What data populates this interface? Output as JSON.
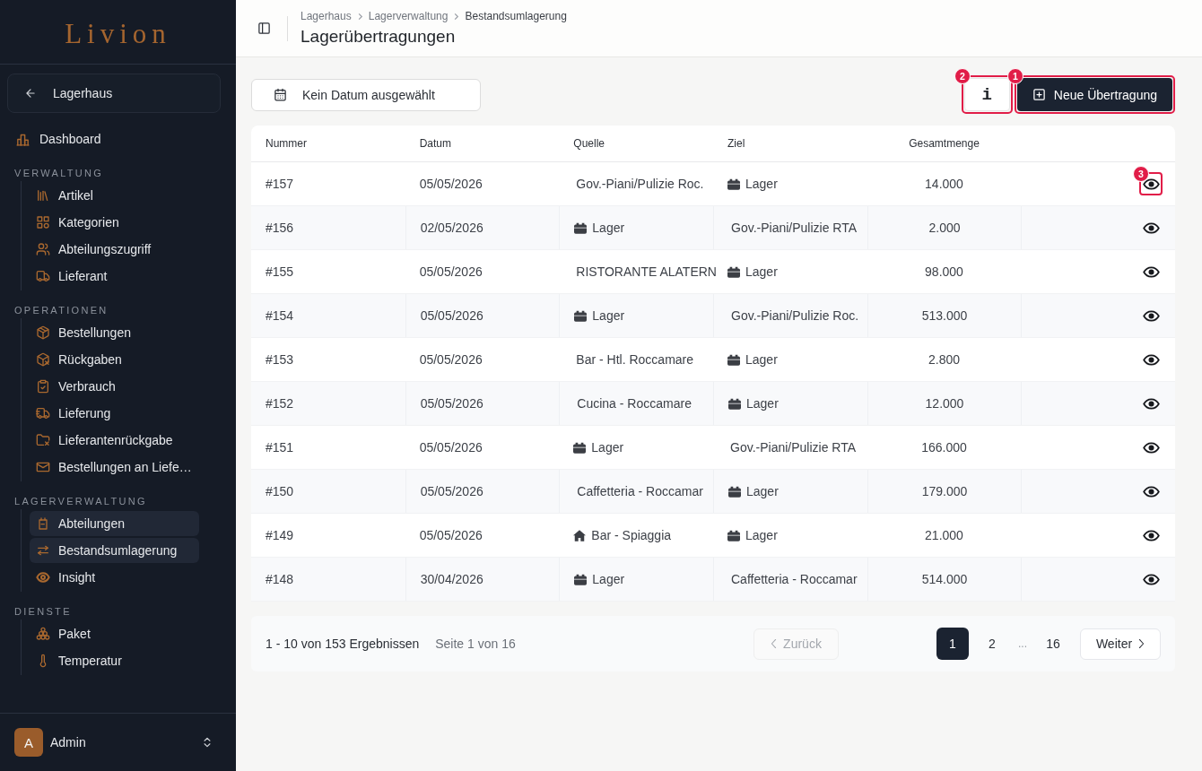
{
  "sidebar": {
    "logo": "Livion",
    "back_link": "Lagerhaus",
    "top_items": [
      {
        "label": "Dashboard",
        "selected": false
      }
    ],
    "sections": [
      {
        "title": "VERWALTUNG",
        "items": [
          {
            "label": "Artikel",
            "selected": false
          },
          {
            "label": "Kategorien",
            "selected": false
          },
          {
            "label": "Abteilungszugriff",
            "selected": false
          },
          {
            "label": "Lieferant",
            "selected": false
          }
        ]
      },
      {
        "title": "OPERATIONEN",
        "items": [
          {
            "label": "Bestellungen",
            "selected": false
          },
          {
            "label": "Rückgaben",
            "selected": false
          },
          {
            "label": "Verbrauch",
            "selected": false
          },
          {
            "label": "Lieferung",
            "selected": false
          },
          {
            "label": "Lieferantenrückgabe",
            "selected": false
          },
          {
            "label": "Bestellungen an Liefe…",
            "selected": false
          }
        ]
      },
      {
        "title": "LAGERVERWALTUNG",
        "items": [
          {
            "label": "Abteilungen",
            "selected": true
          },
          {
            "label": "Bestandsumlagerung",
            "selected": true
          },
          {
            "label": "Insight",
            "selected": false
          }
        ]
      },
      {
        "title": "DIENSTE",
        "items": [
          {
            "label": "Paket",
            "selected": false
          },
          {
            "label": "Temperatur",
            "selected": false
          }
        ]
      }
    ],
    "user": {
      "initial": "A",
      "name": "Admin"
    }
  },
  "header": {
    "breadcrumb": [
      "Lagerhaus",
      "Lagerverwaltung",
      "Bestandsumlagerung"
    ],
    "title": "Lagerübertragungen"
  },
  "toolbar": {
    "date_filter": "Kein Datum ausgewählt",
    "info_button": {
      "label": "i",
      "callout": "2"
    },
    "new_button": {
      "label": "Neue Übertragung",
      "callout": "1"
    }
  },
  "table": {
    "columns": [
      "Nummer",
      "Datum",
      "Quelle",
      "Ziel",
      "Gesamtmenge"
    ],
    "rows": [
      {
        "number": "#157",
        "date": "05/05/2026",
        "source": {
          "name": "Gov.-Piani/Pulizie Roc.",
          "kind": "plain"
        },
        "target": {
          "name": "Lager",
          "kind": "warehouse"
        },
        "quantity": "14.000",
        "callout": "3"
      },
      {
        "number": "#156",
        "date": "02/05/2026",
        "source": {
          "name": "Lager",
          "kind": "warehouse"
        },
        "target": {
          "name": "Gov.-Piani/Pulizie RTA",
          "kind": "plain"
        },
        "quantity": "2.000"
      },
      {
        "number": "#155",
        "date": "05/05/2026",
        "source": {
          "name": "RISTORANTE ALATERN",
          "kind": "plain"
        },
        "target": {
          "name": "Lager",
          "kind": "warehouse"
        },
        "quantity": "98.000"
      },
      {
        "number": "#154",
        "date": "05/05/2026",
        "source": {
          "name": "Lager",
          "kind": "warehouse"
        },
        "target": {
          "name": "Gov.-Piani/Pulizie Roc.",
          "kind": "plain"
        },
        "quantity": "513.000"
      },
      {
        "number": "#153",
        "date": "05/05/2026",
        "source": {
          "name": "Bar - Htl. Roccamare",
          "kind": "plain"
        },
        "target": {
          "name": "Lager",
          "kind": "warehouse"
        },
        "quantity": "2.800"
      },
      {
        "number": "#152",
        "date": "05/05/2026",
        "source": {
          "name": "Cucina - Roccamare",
          "kind": "plain"
        },
        "target": {
          "name": "Lager",
          "kind": "warehouse"
        },
        "quantity": "12.000"
      },
      {
        "number": "#151",
        "date": "05/05/2026",
        "source": {
          "name": "Lager",
          "kind": "warehouse"
        },
        "target": {
          "name": "Gov.-Piani/Pulizie RTA",
          "kind": "plain"
        },
        "quantity": "166.000"
      },
      {
        "number": "#150",
        "date": "05/05/2026",
        "source": {
          "name": "Caffetteria - Roccamar",
          "kind": "plain"
        },
        "target": {
          "name": "Lager",
          "kind": "warehouse"
        },
        "quantity": "179.000"
      },
      {
        "number": "#149",
        "date": "05/05/2026",
        "source": {
          "name": "Bar - Spiaggia",
          "kind": "home"
        },
        "target": {
          "name": "Lager",
          "kind": "warehouse"
        },
        "quantity": "21.000"
      },
      {
        "number": "#148",
        "date": "30/04/2026",
        "source": {
          "name": "Lager",
          "kind": "warehouse"
        },
        "target": {
          "name": "Caffetteria - Roccamar",
          "kind": "plain"
        },
        "quantity": "514.000"
      }
    ]
  },
  "pagination": {
    "summary": "1 - 10 von 153 Ergebnissen",
    "page_info": "Seite 1 von 16",
    "previous": {
      "label": "Zurück",
      "disabled": true
    },
    "pages": [
      {
        "label": "1",
        "kind": "page",
        "selected": true
      },
      {
        "label": "2",
        "kind": "page",
        "selected": false
      },
      {
        "label": "...",
        "kind": "ellipsis",
        "selected": false
      },
      {
        "label": "16",
        "kind": "page",
        "selected": false
      }
    ],
    "next": {
      "label": "Weiter",
      "disabled": false
    }
  }
}
